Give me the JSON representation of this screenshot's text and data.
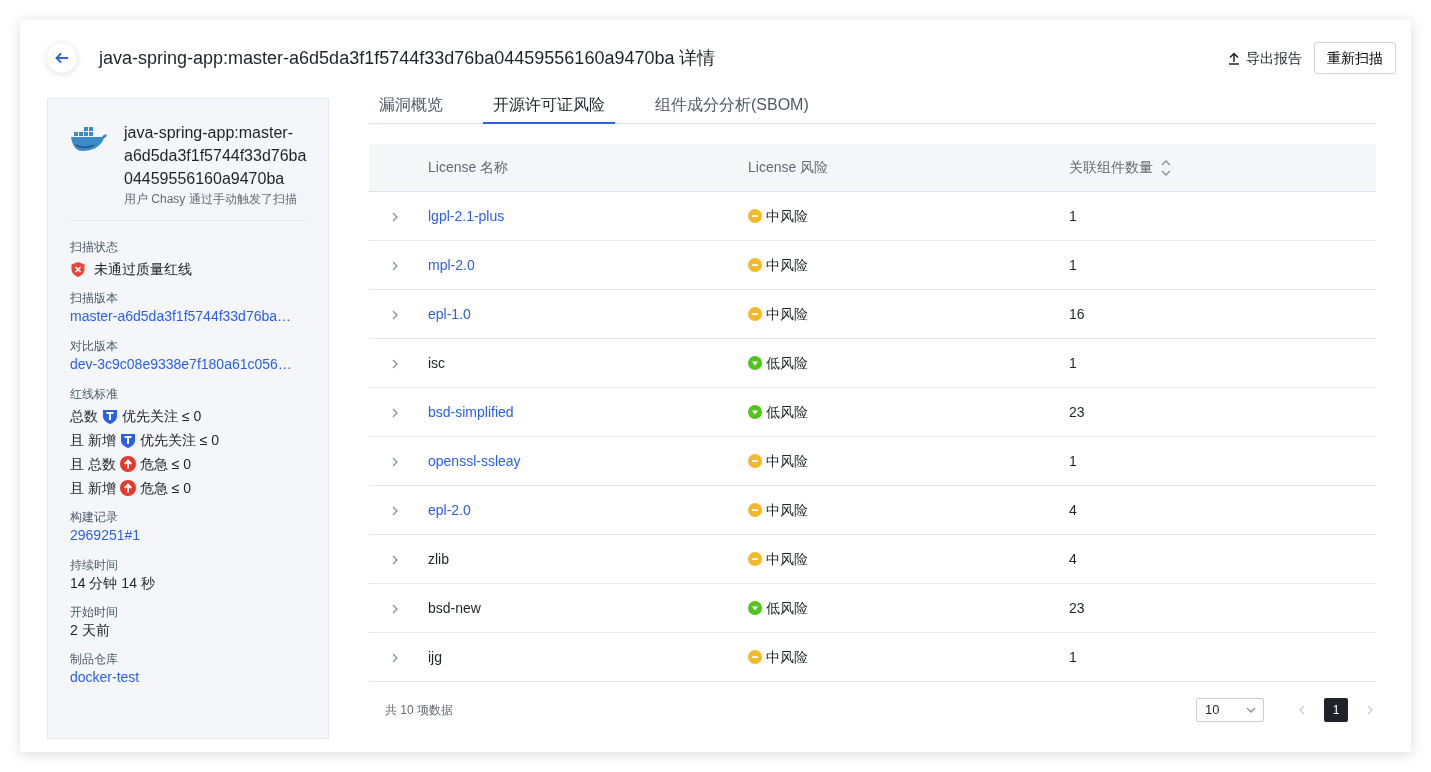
{
  "header": {
    "title": "java-spring-app:master-a6d5da3f1f5744f33d76ba04459556160a9470ba 详情",
    "actions": [
      {
        "kind": "link",
        "label": "导出报告"
      },
      {
        "kind": "button",
        "label": "重新扫描"
      }
    ]
  },
  "sidebar": {
    "image_name": "java-spring-app:master-a6d5da3f1f5744f33d76ba04459556160a9470ba",
    "trigger_note": "用户 Chasy 通过手动触发了扫描",
    "fields": [
      {
        "kind": "status",
        "label": "扫描状态",
        "value": "未通过质量红线"
      },
      {
        "kind": "link",
        "label": "扫描版本",
        "value": "master-a6d5da3f1f5744f33d76ba…"
      },
      {
        "kind": "link",
        "label": "对比版本",
        "value": "dev-3c9c08e9338e7f180a61c056…"
      },
      {
        "kind": "criteria",
        "label": "红线标准",
        "lines": [
          {
            "prefix": "总数",
            "kind": "priority",
            "severity": "优先关注",
            "condition": "≤ 0"
          },
          {
            "prefix": "且 新增",
            "kind": "priority",
            "severity": "优先关注",
            "condition": "≤ 0"
          },
          {
            "prefix": "且 总数",
            "kind": "critical",
            "severity": "危急",
            "condition": "≤ 0"
          },
          {
            "prefix": "且 新增",
            "kind": "critical",
            "severity": "危急",
            "condition": "≤ 0"
          }
        ]
      },
      {
        "kind": "link",
        "label": "构建记录",
        "value": "2969251#1"
      },
      {
        "kind": "text",
        "label": "持续时间",
        "value": "14 分钟 14 秒"
      },
      {
        "kind": "text",
        "label": "开始时间",
        "value": "2 天前"
      },
      {
        "kind": "link",
        "label": "制品仓库",
        "value": "docker-test"
      }
    ]
  },
  "tabs": [
    {
      "label": "漏洞概览",
      "selected": false
    },
    {
      "label": "开源许可证风险",
      "selected": true
    },
    {
      "label": "组件成分分析(SBOM)",
      "selected": false
    }
  ],
  "table": {
    "columns": [
      "License 名称",
      "License 风险",
      "关联组件数量"
    ],
    "rows": [
      {
        "name": "lgpl-2.1-plus",
        "linked": true,
        "kind": "medium",
        "risk_label": "中风险",
        "count": "1"
      },
      {
        "name": "mpl-2.0",
        "linked": true,
        "kind": "medium",
        "risk_label": "中风险",
        "count": "1"
      },
      {
        "name": "epl-1.0",
        "linked": true,
        "kind": "medium",
        "risk_label": "中风险",
        "count": "16"
      },
      {
        "name": "isc",
        "linked": false,
        "kind": "low",
        "risk_label": "低风险",
        "count": "1"
      },
      {
        "name": "bsd-simplified",
        "linked": true,
        "kind": "low",
        "risk_label": "低风险",
        "count": "23"
      },
      {
        "name": "openssl-ssleay",
        "linked": true,
        "kind": "medium",
        "risk_label": "中风险",
        "count": "1"
      },
      {
        "name": "epl-2.0",
        "linked": true,
        "kind": "medium",
        "risk_label": "中风险",
        "count": "4"
      },
      {
        "name": "zlib",
        "linked": false,
        "kind": "medium",
        "risk_label": "中风险",
        "count": "4"
      },
      {
        "name": "bsd-new",
        "linked": false,
        "kind": "low",
        "risk_label": "低风险",
        "count": "23"
      },
      {
        "name": "ijg",
        "linked": false,
        "kind": "medium",
        "risk_label": "中风险",
        "count": "1"
      }
    ]
  },
  "pagination": {
    "total": "共 10 项数据",
    "page_size": "10",
    "pages": [
      {
        "label": "1",
        "selected": true
      }
    ]
  }
}
